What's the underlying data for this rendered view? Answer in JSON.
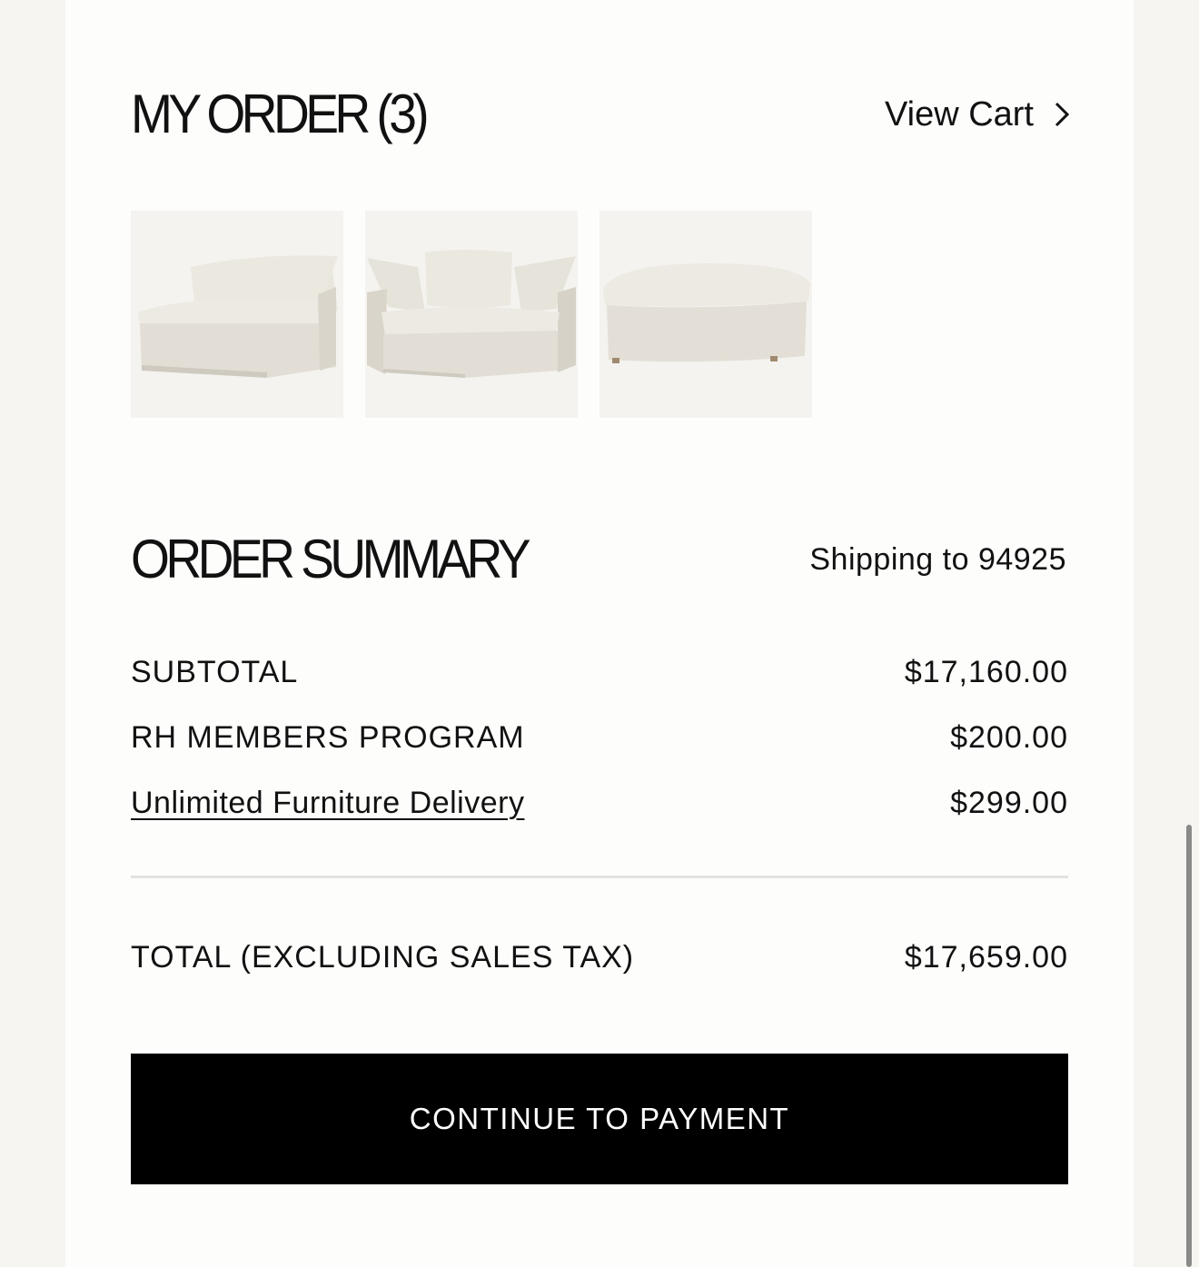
{
  "my_order": {
    "title": "MY ORDER (3)",
    "view_cart_label": "View Cart",
    "view_cart_icon": "chevron-right-icon",
    "items": [
      {
        "icon": "sofa-armless-chair-image"
      },
      {
        "icon": "sofa-corner-chair-image"
      },
      {
        "icon": "ottoman-image"
      }
    ]
  },
  "order_summary": {
    "title": "ORDER SUMMARY",
    "shipping": "Shipping to 94925",
    "rows": [
      {
        "label": "SUBTOTAL",
        "value": "$17,160.00"
      },
      {
        "label": "RH MEMBERS PROGRAM",
        "value": "$200.00"
      },
      {
        "label": "Unlimited Furniture Delivery",
        "value": "$299.00"
      }
    ],
    "total_label": "TOTAL (EXCLUDING SALES TAX)",
    "total_value": "$17,659.00"
  },
  "cta": {
    "label": "CONTINUE TO PAYMENT"
  },
  "colors": {
    "page_background": "#f6f5f1",
    "panel_background": "#fdfdfc",
    "button_background": "#000000",
    "button_text": "#ffffff",
    "fabric": "#e7e3da"
  }
}
